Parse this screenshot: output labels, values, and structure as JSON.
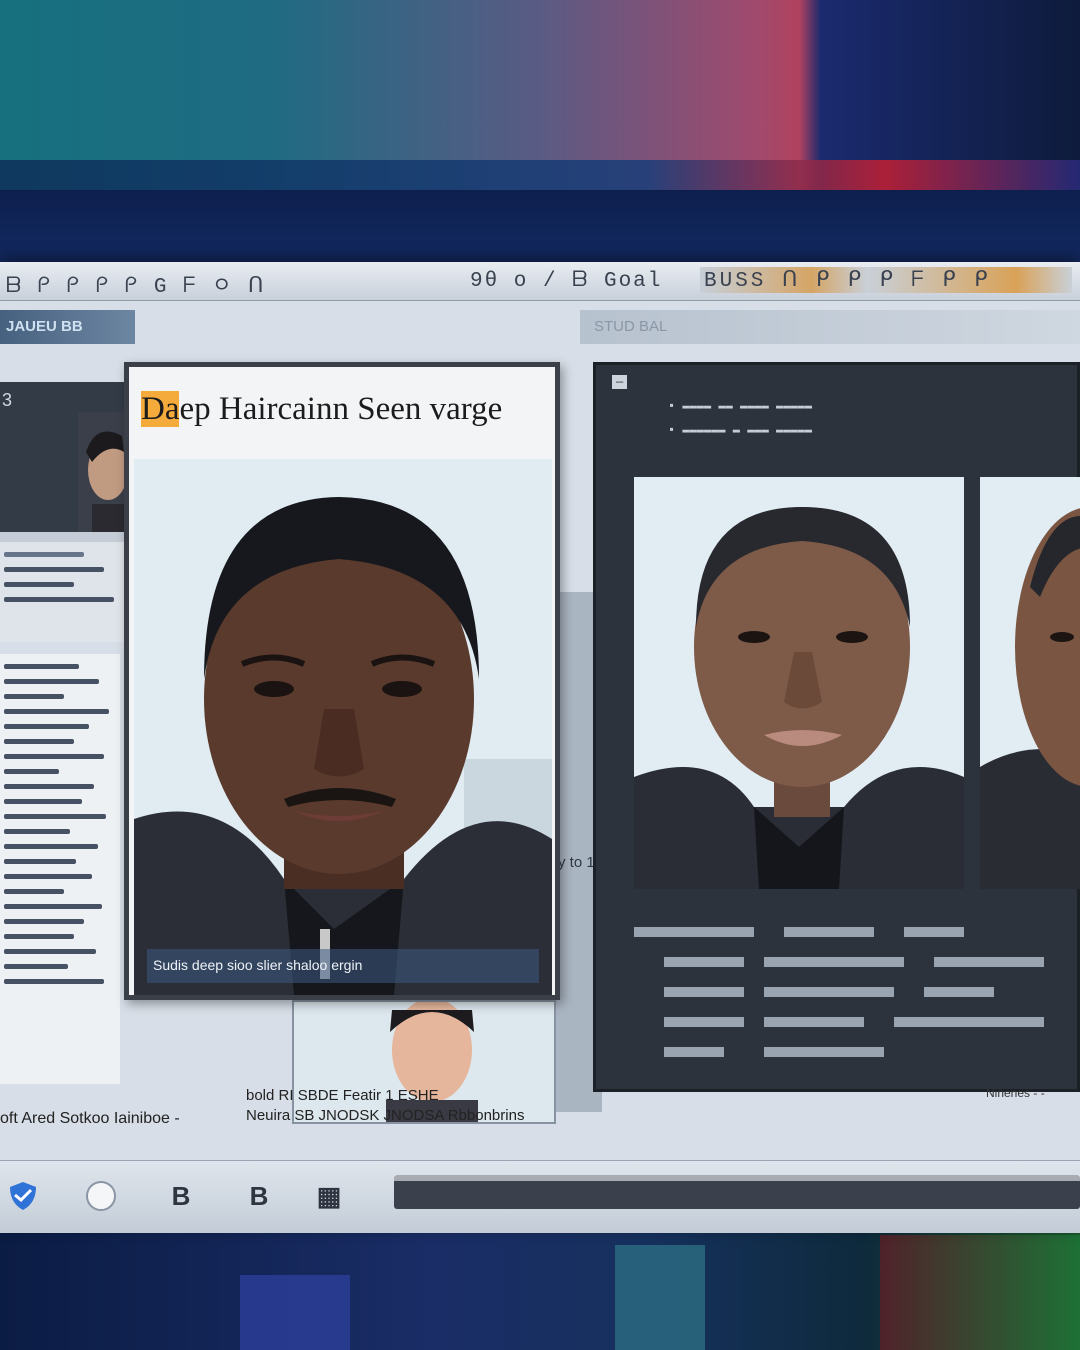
{
  "toolbar": {
    "left_glyphs": "ᗷ ᑭ ᑭ ᑭ ᑭ G ᖴ ㅇ ᑎ",
    "mid_glyphs": "9θ o / ᗷ Goal",
    "right_glyphs": "BUSS ᑎ ᑭ ᑭ ᑭ ᖴ ᑭ ᑭ"
  },
  "left_panel": {
    "subbar": "JAUEU BB",
    "number": "3"
  },
  "right_subbar": "STUD BAL",
  "main_card": {
    "title_highlight": "Da",
    "title_rest": "ep Haircainn Seen varge",
    "caption": "Sudis deep sioo slier shaloo ergin"
  },
  "mid_strip_label": "y to 1",
  "right_panel": {
    "header_line1": "—",
    "header_line2": "▪ ▬▬▬▬ ▬▬ ▬▬▬▬ ▬▬▬▬▬",
    "header_line3": "▪ ▬▬▬▬▬▬ ▬ ▬▬▬ ▬▬▬▬▬"
  },
  "captions": {
    "left": "oft  Ared Sotkoo  Iainiboe  -",
    "mid_line1": "bold  RI SBDE  Featir  1 ESHE",
    "mid_line2": "Neuira  SB  JNODSK  JNODSA  Rbbonbrins",
    "right": "Ninenes -  -"
  },
  "taskbar": {
    "b1": "B",
    "b2": "B",
    "grid": "▦"
  },
  "colors": {
    "highlight": "#f5ab3b",
    "screen_bg": "#d7dee7",
    "panel_dark": "#2d333c"
  },
  "icons": [
    "shield-icon",
    "globe-icon",
    "bold-b-icon",
    "bold-b-icon",
    "grid-icon"
  ]
}
